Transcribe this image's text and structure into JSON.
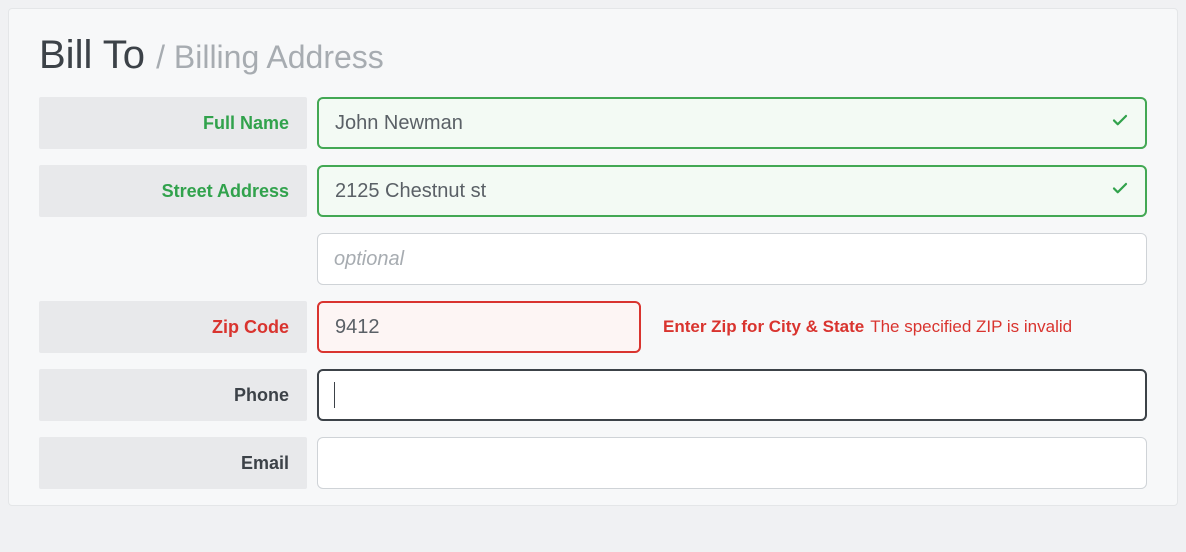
{
  "heading": {
    "main": "Bill To ",
    "sub": "/ Billing Address"
  },
  "fields": {
    "full_name": {
      "label": "Full Name",
      "value": "John Newman"
    },
    "street": {
      "label": "Street Address",
      "value": "2125 Chestnut st"
    },
    "street2": {
      "placeholder": "optional"
    },
    "zip": {
      "label": "Zip Code",
      "value": "9412",
      "hint_strong": "Enter Zip for City & State",
      "hint_msg": "The specified ZIP is invalid"
    },
    "phone": {
      "label": "Phone",
      "value": ""
    },
    "email": {
      "label": "Email",
      "value": ""
    }
  }
}
